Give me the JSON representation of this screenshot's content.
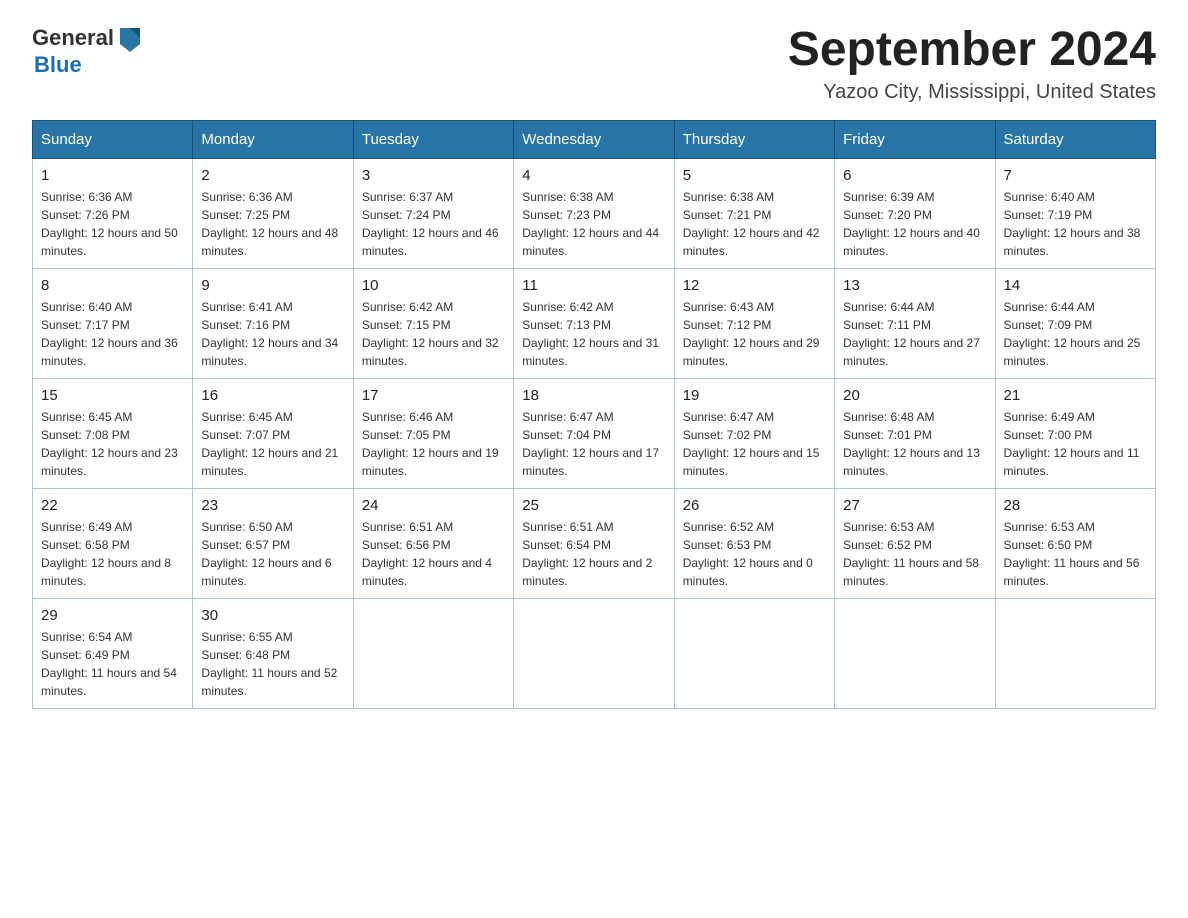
{
  "header": {
    "logo_general": "General",
    "logo_blue": "Blue",
    "month_title": "September 2024",
    "location": "Yazoo City, Mississippi, United States"
  },
  "days_of_week": [
    "Sunday",
    "Monday",
    "Tuesday",
    "Wednesday",
    "Thursday",
    "Friday",
    "Saturday"
  ],
  "weeks": [
    [
      {
        "day": "1",
        "sunrise": "6:36 AM",
        "sunset": "7:26 PM",
        "daylight": "12 hours and 50 minutes."
      },
      {
        "day": "2",
        "sunrise": "6:36 AM",
        "sunset": "7:25 PM",
        "daylight": "12 hours and 48 minutes."
      },
      {
        "day": "3",
        "sunrise": "6:37 AM",
        "sunset": "7:24 PM",
        "daylight": "12 hours and 46 minutes."
      },
      {
        "day": "4",
        "sunrise": "6:38 AM",
        "sunset": "7:23 PM",
        "daylight": "12 hours and 44 minutes."
      },
      {
        "day": "5",
        "sunrise": "6:38 AM",
        "sunset": "7:21 PM",
        "daylight": "12 hours and 42 minutes."
      },
      {
        "day": "6",
        "sunrise": "6:39 AM",
        "sunset": "7:20 PM",
        "daylight": "12 hours and 40 minutes."
      },
      {
        "day": "7",
        "sunrise": "6:40 AM",
        "sunset": "7:19 PM",
        "daylight": "12 hours and 38 minutes."
      }
    ],
    [
      {
        "day": "8",
        "sunrise": "6:40 AM",
        "sunset": "7:17 PM",
        "daylight": "12 hours and 36 minutes."
      },
      {
        "day": "9",
        "sunrise": "6:41 AM",
        "sunset": "7:16 PM",
        "daylight": "12 hours and 34 minutes."
      },
      {
        "day": "10",
        "sunrise": "6:42 AM",
        "sunset": "7:15 PM",
        "daylight": "12 hours and 32 minutes."
      },
      {
        "day": "11",
        "sunrise": "6:42 AM",
        "sunset": "7:13 PM",
        "daylight": "12 hours and 31 minutes."
      },
      {
        "day": "12",
        "sunrise": "6:43 AM",
        "sunset": "7:12 PM",
        "daylight": "12 hours and 29 minutes."
      },
      {
        "day": "13",
        "sunrise": "6:44 AM",
        "sunset": "7:11 PM",
        "daylight": "12 hours and 27 minutes."
      },
      {
        "day": "14",
        "sunrise": "6:44 AM",
        "sunset": "7:09 PM",
        "daylight": "12 hours and 25 minutes."
      }
    ],
    [
      {
        "day": "15",
        "sunrise": "6:45 AM",
        "sunset": "7:08 PM",
        "daylight": "12 hours and 23 minutes."
      },
      {
        "day": "16",
        "sunrise": "6:45 AM",
        "sunset": "7:07 PM",
        "daylight": "12 hours and 21 minutes."
      },
      {
        "day": "17",
        "sunrise": "6:46 AM",
        "sunset": "7:05 PM",
        "daylight": "12 hours and 19 minutes."
      },
      {
        "day": "18",
        "sunrise": "6:47 AM",
        "sunset": "7:04 PM",
        "daylight": "12 hours and 17 minutes."
      },
      {
        "day": "19",
        "sunrise": "6:47 AM",
        "sunset": "7:02 PM",
        "daylight": "12 hours and 15 minutes."
      },
      {
        "day": "20",
        "sunrise": "6:48 AM",
        "sunset": "7:01 PM",
        "daylight": "12 hours and 13 minutes."
      },
      {
        "day": "21",
        "sunrise": "6:49 AM",
        "sunset": "7:00 PM",
        "daylight": "12 hours and 11 minutes."
      }
    ],
    [
      {
        "day": "22",
        "sunrise": "6:49 AM",
        "sunset": "6:58 PM",
        "daylight": "12 hours and 8 minutes."
      },
      {
        "day": "23",
        "sunrise": "6:50 AM",
        "sunset": "6:57 PM",
        "daylight": "12 hours and 6 minutes."
      },
      {
        "day": "24",
        "sunrise": "6:51 AM",
        "sunset": "6:56 PM",
        "daylight": "12 hours and 4 minutes."
      },
      {
        "day": "25",
        "sunrise": "6:51 AM",
        "sunset": "6:54 PM",
        "daylight": "12 hours and 2 minutes."
      },
      {
        "day": "26",
        "sunrise": "6:52 AM",
        "sunset": "6:53 PM",
        "daylight": "12 hours and 0 minutes."
      },
      {
        "day": "27",
        "sunrise": "6:53 AM",
        "sunset": "6:52 PM",
        "daylight": "11 hours and 58 minutes."
      },
      {
        "day": "28",
        "sunrise": "6:53 AM",
        "sunset": "6:50 PM",
        "daylight": "11 hours and 56 minutes."
      }
    ],
    [
      {
        "day": "29",
        "sunrise": "6:54 AM",
        "sunset": "6:49 PM",
        "daylight": "11 hours and 54 minutes."
      },
      {
        "day": "30",
        "sunrise": "6:55 AM",
        "sunset": "6:48 PM",
        "daylight": "11 hours and 52 minutes."
      },
      null,
      null,
      null,
      null,
      null
    ]
  ]
}
